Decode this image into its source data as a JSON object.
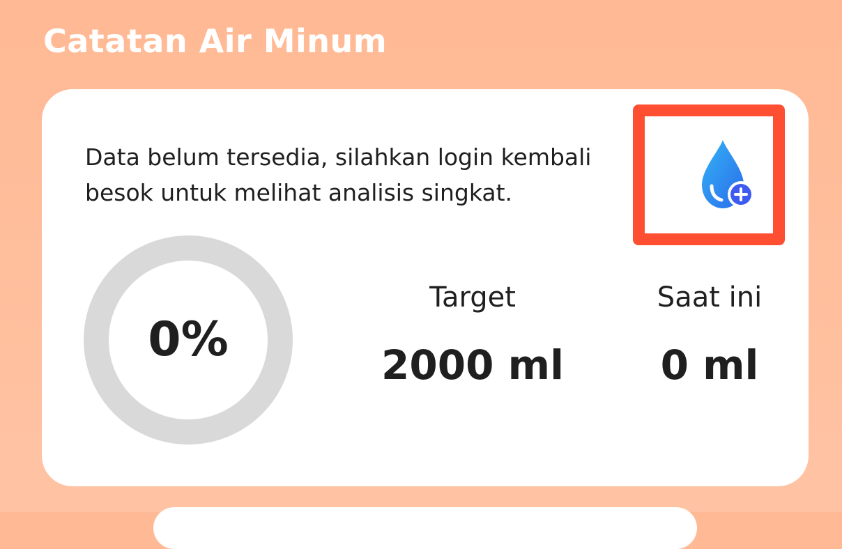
{
  "header": {
    "title": "Catatan Air Minum"
  },
  "card": {
    "message": "Data belum tersedia, silahkan login kembali besok untuk melihat analisis singkat.",
    "add_button": {
      "icon": "water-drop-plus-icon"
    },
    "progress": {
      "label": "0%",
      "fraction": 0
    },
    "target": {
      "label": "Target",
      "value": "2000 ml"
    },
    "current": {
      "label": "Saat ini",
      "value": "0 ml"
    }
  },
  "colors": {
    "background": "#FFB994",
    "card": "#FFFFFF",
    "ring_track": "#D9D9D9",
    "highlight": "#FF4F33",
    "drop_light": "#2EA3F2",
    "drop_dark": "#2A56E8",
    "text": "#1F1F1F"
  }
}
